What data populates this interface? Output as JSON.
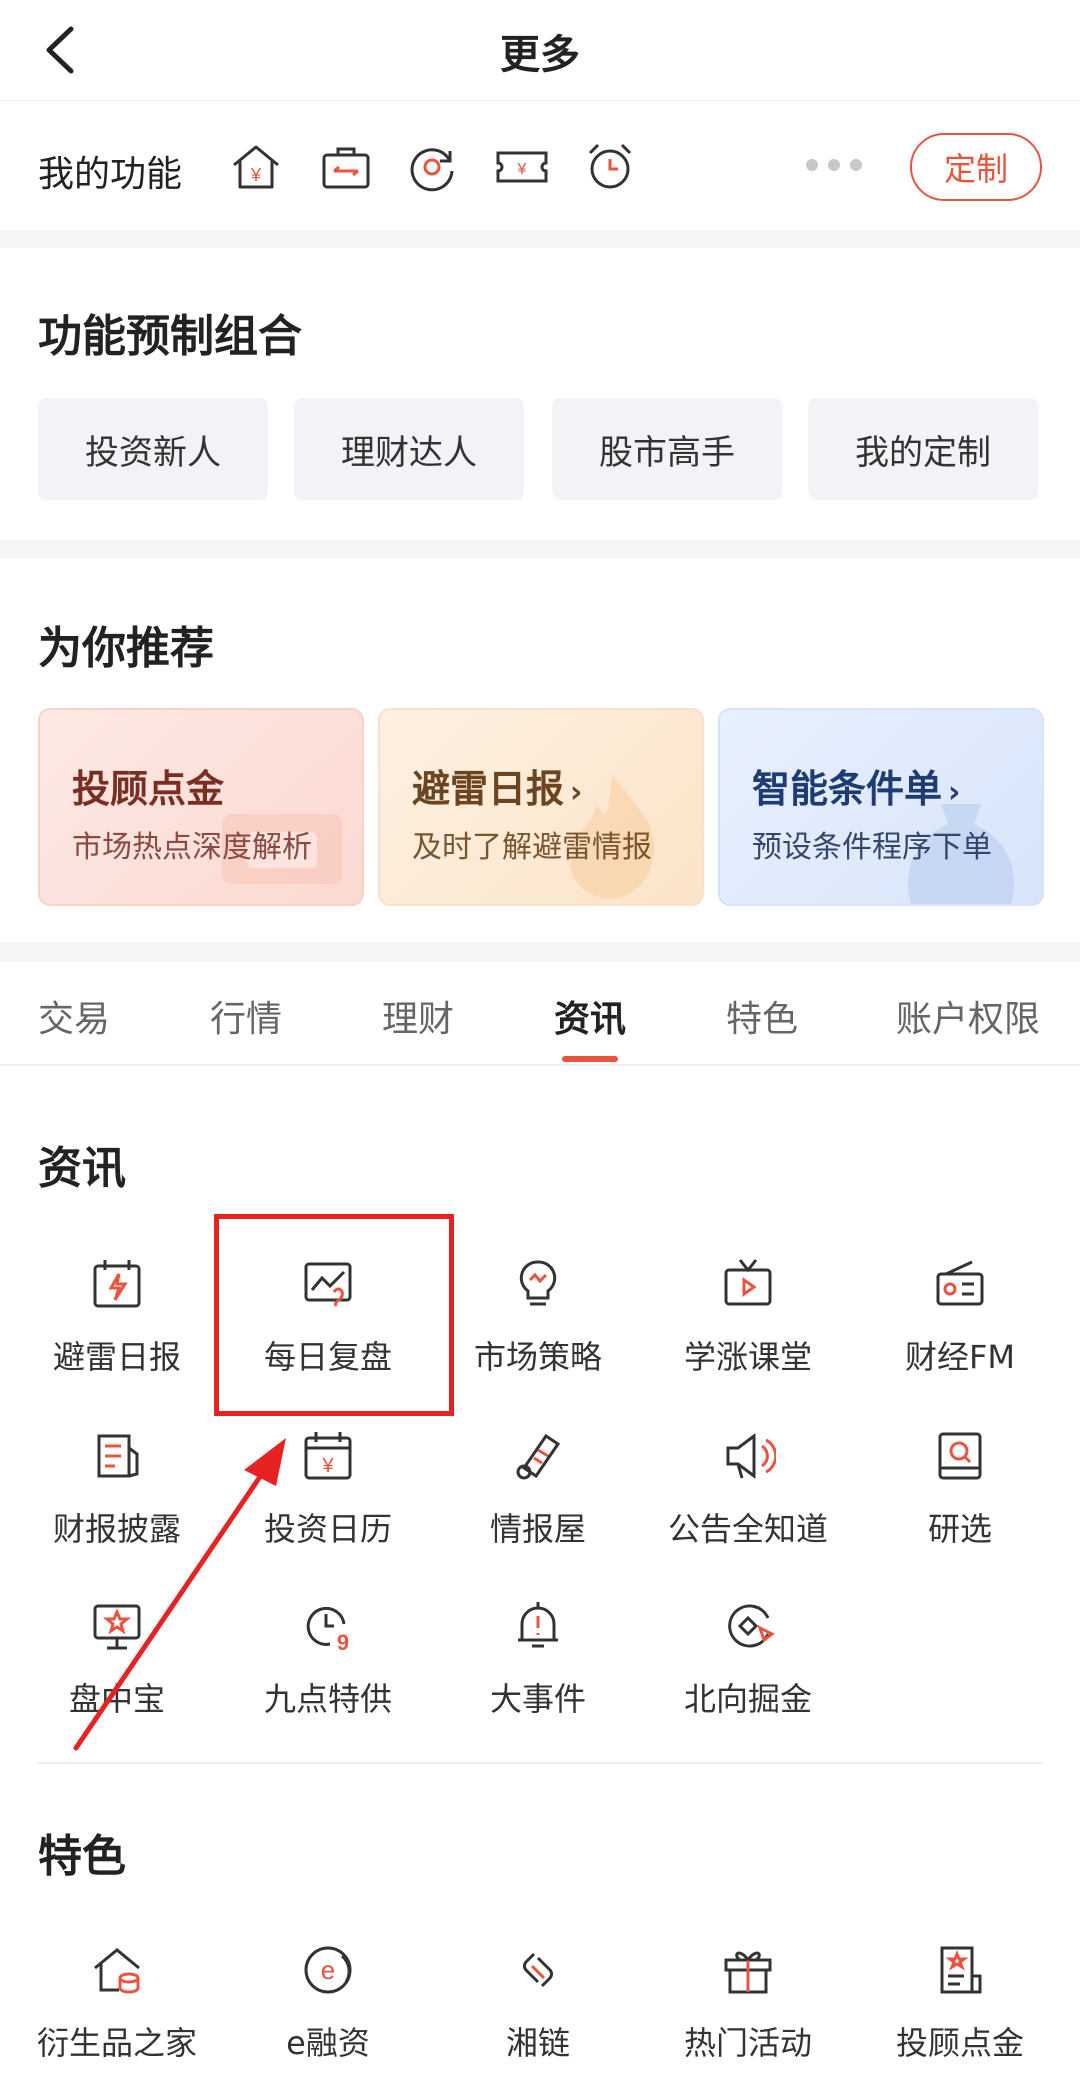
{
  "header": {
    "title": "更多"
  },
  "my_functions": {
    "label": "我的功能",
    "icons": [
      "house-yuan-icon",
      "briefcase-transfer-icon",
      "target-refresh-icon",
      "ticket-yuan-icon",
      "alarm-clock-icon"
    ],
    "custom_label": "定制"
  },
  "presets": {
    "title": "功能预制组合",
    "items": [
      "投资新人",
      "理财达人",
      "股市高手",
      "我的定制"
    ]
  },
  "recommend": {
    "title": "为你推荐",
    "cards": [
      {
        "title": "投顾点金",
        "subtitle": "市场热点深度解析",
        "title_color": "#7a2e23",
        "sub_color": "#8a4a40"
      },
      {
        "title": "避雷日报",
        "chevron": "›",
        "subtitle": "及时了解避雷情报",
        "title_color": "#6b4420",
        "sub_color": "#7a5630"
      },
      {
        "title": "智能条件单",
        "chevron": "›",
        "subtitle": "预设条件程序下单",
        "title_color": "#1f3b73",
        "sub_color": "#33466e"
      }
    ]
  },
  "tabs": {
    "items": [
      "交易",
      "行情",
      "理财",
      "资讯",
      "特色",
      "账户权限"
    ],
    "active": "资讯"
  },
  "info_section": {
    "title": "资讯",
    "items": [
      {
        "label": "避雷日报",
        "icon": "lightning-calendar-icon"
      },
      {
        "label": "每日复盘",
        "icon": "chart-review-icon"
      },
      {
        "label": "市场策略",
        "icon": "lightbulb-icon"
      },
      {
        "label": "学涨课堂",
        "icon": "tv-play-icon"
      },
      {
        "label": "财经FM",
        "icon": "radio-icon"
      },
      {
        "label": "财报披露",
        "icon": "report-document-icon"
      },
      {
        "label": "投资日历",
        "icon": "calendar-yuan-icon"
      },
      {
        "label": "情报屋",
        "icon": "scroll-icon"
      },
      {
        "label": "公告全知道",
        "icon": "megaphone-icon"
      },
      {
        "label": "研选",
        "icon": "research-book-icon"
      },
      {
        "label": "盘中宝",
        "icon": "monitor-star-icon"
      },
      {
        "label": "九点特供",
        "icon": "clock-nine-icon"
      },
      {
        "label": "大事件",
        "icon": "bell-alert-icon"
      },
      {
        "label": "北向掘金",
        "icon": "compass-icon"
      }
    ]
  },
  "feature_section": {
    "title": "特色",
    "items": [
      {
        "label": "衍生品之家",
        "icon": "home-derivative-icon"
      },
      {
        "label": "e融资",
        "icon": "e-finance-icon"
      },
      {
        "label": "湘链",
        "icon": "chain-link-icon"
      },
      {
        "label": "热门活动",
        "icon": "gift-icon"
      },
      {
        "label": "投顾点金",
        "icon": "advisor-document-icon"
      }
    ]
  },
  "colors": {
    "accent": "#e8543e",
    "annotation": "#e62222"
  }
}
